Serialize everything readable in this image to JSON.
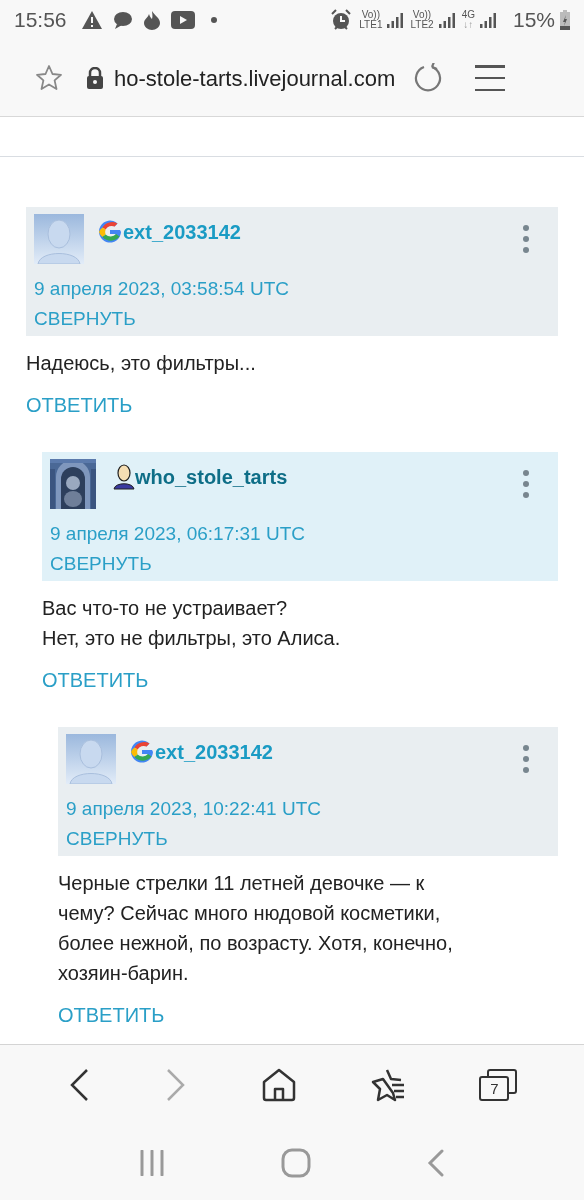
{
  "status_bar": {
    "time": "15:56",
    "network": [
      {
        "top": "Vo))",
        "bottom": "LTE1"
      },
      {
        "top": "Vo))",
        "bottom": "LTE2"
      },
      {
        "top": "4G",
        "bottom": "↓↑"
      }
    ],
    "battery": "15%"
  },
  "address_bar": {
    "url": "ho-stole-tarts.livejournal.com",
    "secure": true
  },
  "comments": [
    {
      "kind": "guest",
      "user": "ext_2033142",
      "date": "9 апреля 2023, 03:58:54 UTC",
      "collapse": "СВЕРНУТЬ",
      "lines": [
        "Надеюсь, это фильтры..."
      ],
      "reply": "ОТВЕТИТЬ",
      "children": [
        {
          "kind": "author",
          "user": "who_stole_tarts",
          "date": "9 апреля 2023, 06:17:31 UTC",
          "collapse": "СВЕРНУТЬ",
          "lines": [
            "Вас что-то не устраивает?",
            "Нет, это не фильтры, это Алиса."
          ],
          "reply": "ОТВЕТИТЬ",
          "children": [
            {
              "kind": "guest",
              "user": "ext_2033142",
              "date": "9 апреля 2023, 10:22:41 UTC",
              "collapse": "СВЕРНУТЬ",
              "lines": [
                "Черные стрелки 11 летней девочке — к",
                "чему? Сейчас много нюдовой косметики,",
                "более нежной, по возрасту. Хотя, конечно,",
                "хозяин-барин."
              ],
              "reply": "ОТВЕТИТЬ"
            }
          ]
        }
      ]
    }
  ],
  "toolbar": {
    "tabs_count": "7",
    "forward_enabled": false
  }
}
